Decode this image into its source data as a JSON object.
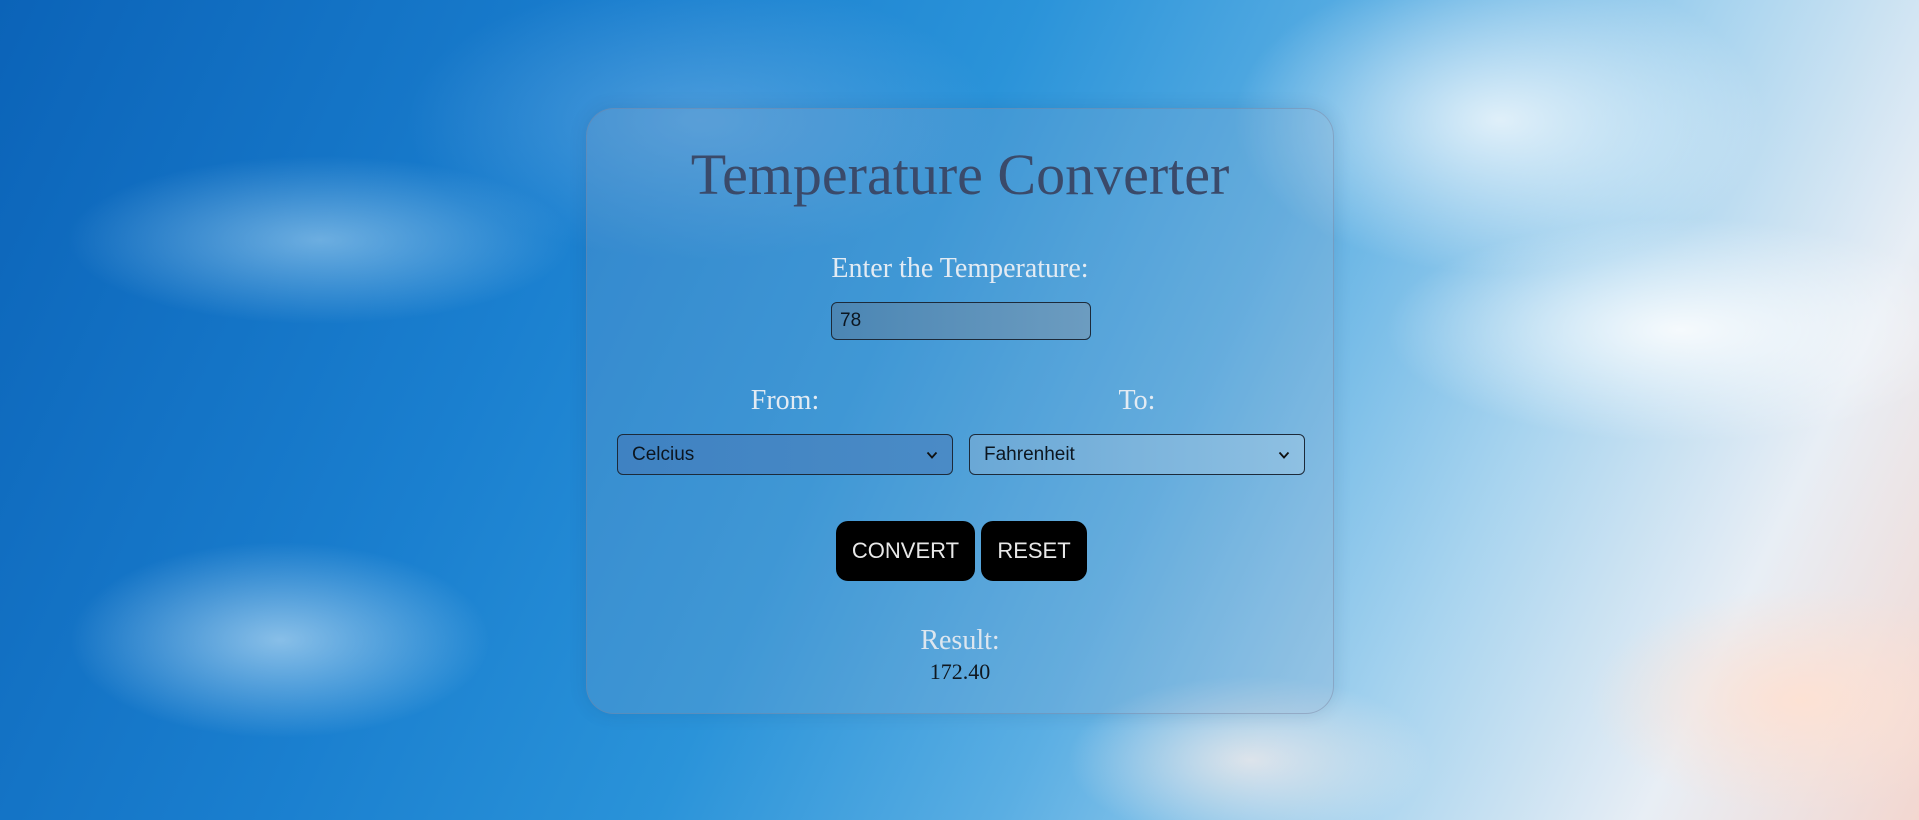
{
  "app": {
    "title": "Temperature Converter"
  },
  "input": {
    "label": "Enter the Temperature:",
    "value": "78"
  },
  "from": {
    "label": "From:",
    "selected": "Celcius"
  },
  "to": {
    "label": "To:",
    "selected": "Fahrenheit"
  },
  "buttons": {
    "convert_label": "CONVERT",
    "reset_label": "RESET"
  },
  "result": {
    "label": "Result:",
    "value": "172.40"
  },
  "icons": {
    "select_arrow": "chevron-down-icon"
  },
  "colors": {
    "title": "#3a4a6a",
    "button_bg": "#000000",
    "button_text": "#e8e8e8"
  }
}
